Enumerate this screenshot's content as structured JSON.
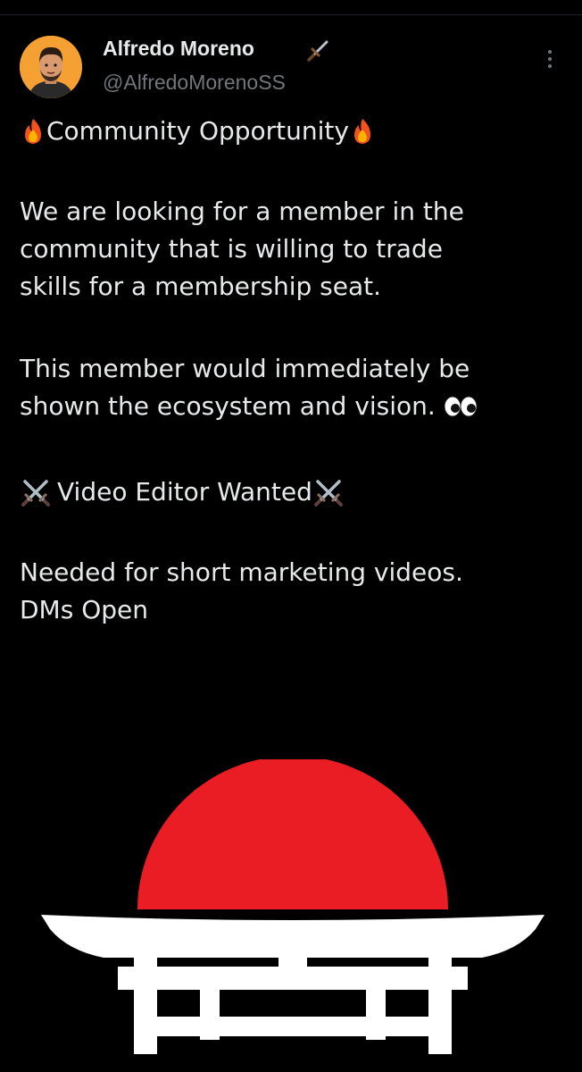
{
  "user": {
    "display_name": "Alfredo Moreno",
    "handle": "@AlfredoMorenoSS",
    "name_badge_icon": "dagger-icon"
  },
  "post": {
    "title": "Community Opportunity",
    "paragraph_1": [
      "We are looking for a member in the",
      "community that is willing to trade",
      "skills for a membership seat."
    ],
    "paragraph_2": [
      "This member would immediately be",
      "shown the ecosystem and vision."
    ],
    "wanted": "Video Editor Wanted",
    "paragraph_3": [
      "Needed for short marketing videos.",
      "DMs Open"
    ],
    "emojis": {
      "title": "fire-emoji",
      "paragraph_2": "eyes-emoji",
      "wanted": "crossed-swords-emoji"
    }
  },
  "colors": {
    "background": "#000000",
    "text": "#e7e9ea",
    "secondary_text": "#71767b",
    "sun_red": "#ea1c24",
    "gate_white": "#ffffff"
  }
}
